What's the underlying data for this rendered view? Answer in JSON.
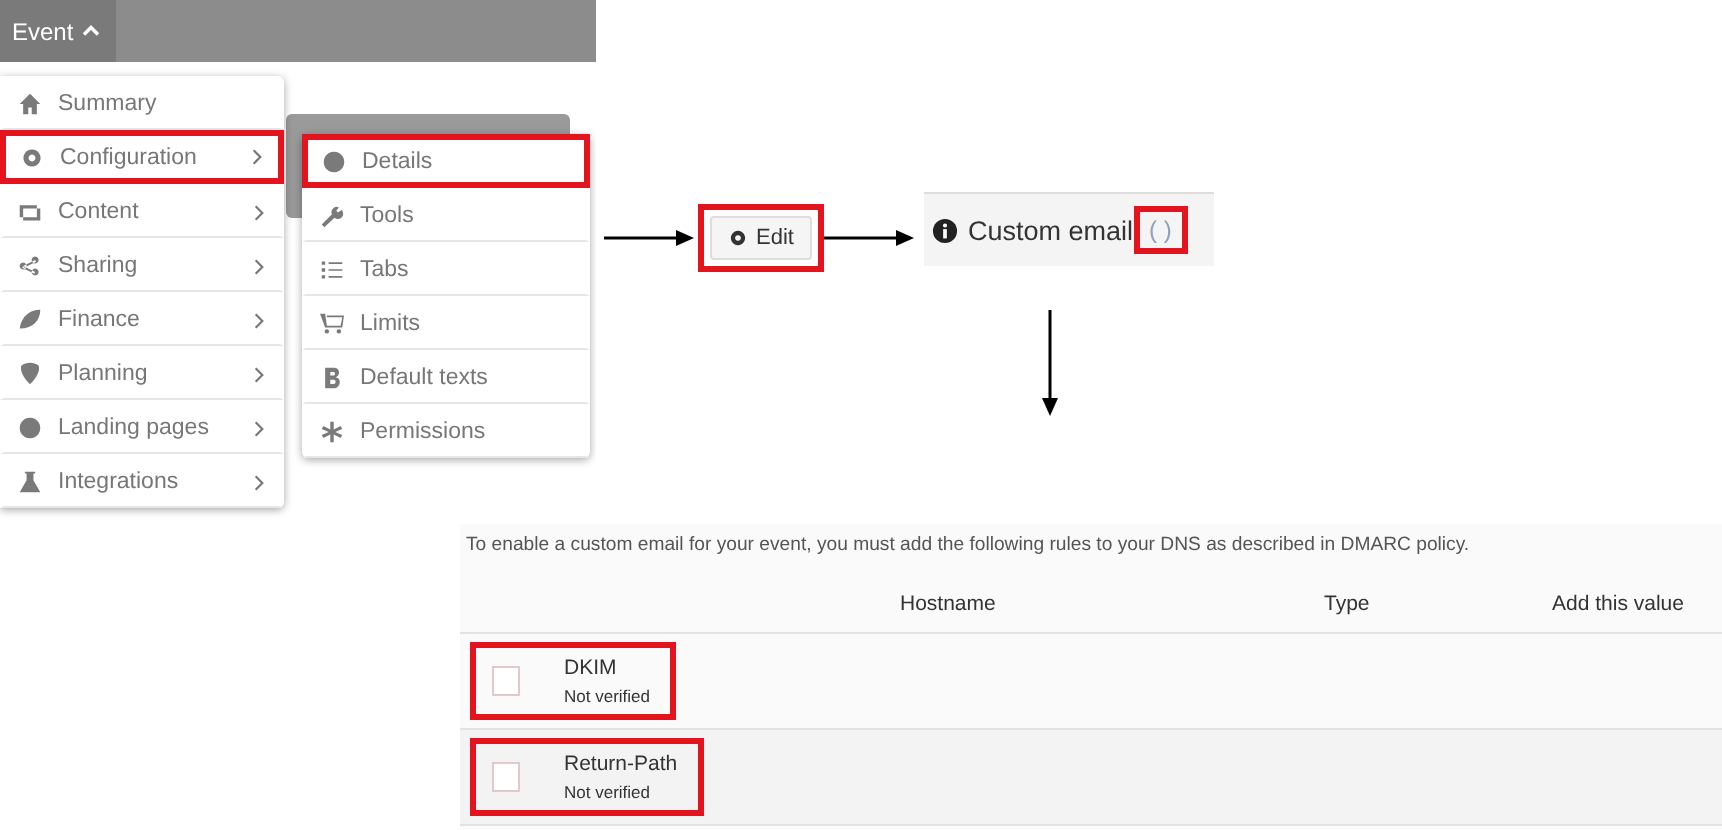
{
  "app_bar": {
    "menu_button": {
      "label": "Event",
      "expanded": true
    }
  },
  "menu": {
    "items": [
      {
        "label": "Summary",
        "has_submenu": false,
        "highlighted": false
      },
      {
        "label": "Configuration",
        "has_submenu": true,
        "highlighted": true
      },
      {
        "label": "Content",
        "has_submenu": true,
        "highlighted": false
      },
      {
        "label": "Sharing",
        "has_submenu": true,
        "highlighted": false
      },
      {
        "label": "Finance",
        "has_submenu": true,
        "highlighted": false
      },
      {
        "label": "Planning",
        "has_submenu": true,
        "highlighted": false
      },
      {
        "label": "Landing pages",
        "has_submenu": true,
        "highlighted": false
      },
      {
        "label": "Integrations",
        "has_submenu": true,
        "highlighted": false
      }
    ]
  },
  "submenu": {
    "items": [
      {
        "label": "Details",
        "highlighted": true
      },
      {
        "label": "Tools",
        "highlighted": false
      },
      {
        "label": "Tabs",
        "highlighted": false
      },
      {
        "label": "Limits",
        "highlighted": false
      },
      {
        "label": "Default texts",
        "highlighted": false
      },
      {
        "label": "Permissions",
        "highlighted": false
      }
    ]
  },
  "edit_button": {
    "label": "Edit",
    "highlighted": true
  },
  "custom_email": {
    "title": "Custom email",
    "value": "( )",
    "highlighted": true
  },
  "dns_panel": {
    "intro": "To enable a custom email for your event, you must add the following rules to your DNS as described in DMARC policy.",
    "columns": [
      "Hostname",
      "Type",
      "Add this value"
    ],
    "rows": [
      {
        "name": "DKIM",
        "status": "Not verified",
        "checked": false,
        "highlighted": true
      },
      {
        "name": "Return-Path",
        "status": "Not verified",
        "checked": false,
        "highlighted": true
      }
    ]
  }
}
